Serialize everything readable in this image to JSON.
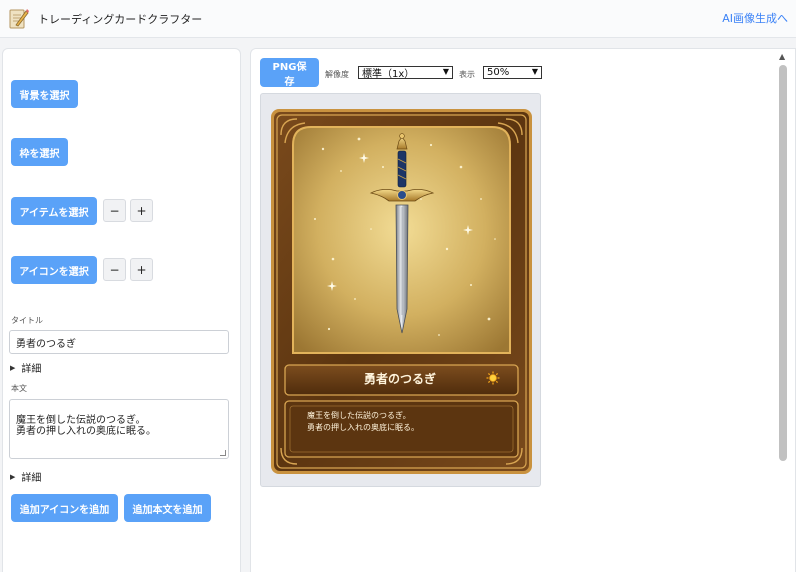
{
  "app": {
    "title": "トレーディングカードクラフター",
    "ai_link": "AI画像生成へ"
  },
  "left": {
    "select_background": "背景を選択",
    "select_frame": "枠を選択",
    "select_item": "アイテムを選択",
    "select_icon": "アイコンを選択",
    "minus": "−",
    "plus": "+",
    "title_label": "タイトル",
    "title_value": "勇者のつるぎ",
    "details": "詳細",
    "body_label": "本文",
    "body_value": "魔王を倒した伝説のつるぎ。\n勇者の押し入れの奥底に眠る。",
    "add_icon": "追加アイコンを追加",
    "add_text": "追加本文を追加"
  },
  "toolbar": {
    "png_save": "PNG保存",
    "resolution_label": "解像度",
    "resolution_value": "標準（1x）",
    "display_label": "表示",
    "display_value": "50%"
  },
  "card": {
    "title": "勇者のつるぎ",
    "body": "魔王を倒した伝説のつるぎ。\n勇者の押し入れの奥底に眠る。",
    "icon": "sun-icon",
    "item": "sword-icon"
  },
  "colors": {
    "accent": "#5aa2f8",
    "frame_brown": "#6b3f16",
    "frame_gold": "#c9923f",
    "background_gold": "#c8a45a"
  }
}
